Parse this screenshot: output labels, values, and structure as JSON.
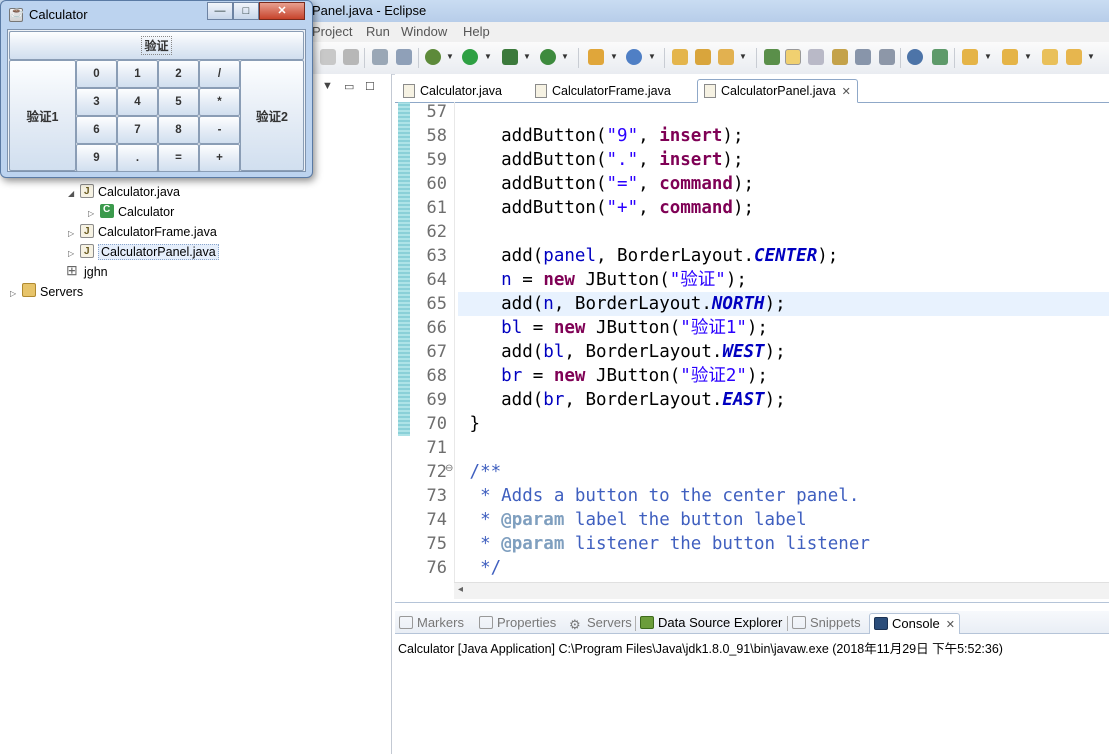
{
  "eclipse": {
    "title_fragment": "Panel.java - Eclipse",
    "menu": [
      "Project",
      "Run",
      "Window",
      "Help"
    ]
  },
  "calculator_window": {
    "title": "Calculator",
    "minimize": "—",
    "maximize": "□",
    "close": "✕",
    "north_button": "验证",
    "west_button": "验证1",
    "east_button": "验证2",
    "grid_buttons": [
      "0",
      "1",
      "2",
      "/",
      "3",
      "4",
      "5",
      "*",
      "6",
      "7",
      "8",
      "-",
      "9",
      ".",
      "=",
      "+"
    ]
  },
  "package_explorer": {
    "items": [
      {
        "label": "Calculator.java",
        "icon": "java-file-icon"
      },
      {
        "label": "Calculator",
        "icon": "class-icon"
      },
      {
        "label": "CalculatorFrame.java",
        "icon": "java-file-icon"
      },
      {
        "label": "CalculatorPanel.java",
        "icon": "java-file-icon"
      },
      {
        "label": "jghn",
        "icon": "package-icon"
      },
      {
        "label": "Servers",
        "icon": "folder-icon"
      }
    ]
  },
  "editor": {
    "tabs": [
      {
        "label": "Calculator.java"
      },
      {
        "label": "CalculatorFrame.java"
      },
      {
        "label": "CalculatorPanel.java",
        "active": true
      }
    ],
    "line_numbers": [
      "57",
      "58",
      "59",
      "60",
      "61",
      "62",
      "63",
      "64",
      "65",
      "66",
      "67",
      "68",
      "69",
      "70",
      "71",
      "72",
      "73",
      "74",
      "75",
      "76"
    ]
  },
  "console_view": {
    "tabs": [
      "Markers",
      "Properties",
      "Servers",
      "Data Source Explorer",
      "Snippets",
      "Console"
    ],
    "launch_line": "Calculator [Java Application] C:\\Program Files\\Java\\jdk1.8.0_91\\bin\\javaw.exe (2018年11月29日 下午5:52:36)"
  },
  "colors": {
    "keyword": "#7f0055",
    "string": "#2a00ff",
    "field": "#0000c0",
    "comment": "#3f5fbf",
    "current_line": "#e8f2fe"
  }
}
